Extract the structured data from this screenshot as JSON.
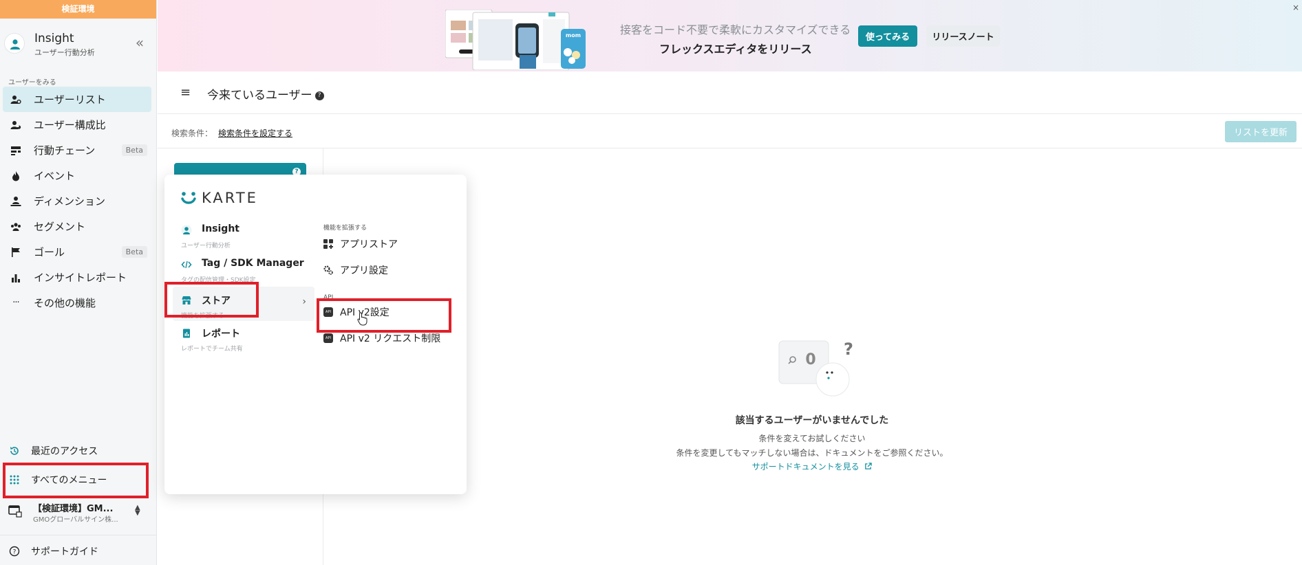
{
  "env_label": "検証環境",
  "app": {
    "title": "Insight",
    "subtitle": "ユーザー行動分析"
  },
  "sidebar": {
    "section_label": "ユーザーをみる",
    "items": [
      {
        "label": "ユーザーリスト",
        "icon": "user-list-icon",
        "active": true
      },
      {
        "label": "ユーザー構成比",
        "icon": "user-ratio-icon"
      },
      {
        "label": "行動チェーン",
        "icon": "action-chain-icon",
        "badge": "Beta"
      },
      {
        "label": "イベント",
        "icon": "event-icon"
      },
      {
        "label": "ディメンション",
        "icon": "dimension-icon"
      },
      {
        "label": "セグメント",
        "icon": "segment-icon"
      },
      {
        "label": "ゴール",
        "icon": "goal-flag-icon",
        "badge": "Beta"
      },
      {
        "label": "インサイトレポート",
        "icon": "report-chart-icon"
      },
      {
        "label": "その他の機能",
        "icon": "more-icon"
      }
    ],
    "recent_access": "最近のアクセス",
    "all_menu": "すべてのメニュー",
    "workspace_name": "【検証環境】GM...",
    "workspace_sub": "GMOグローバルサイン株...",
    "support_guide": "サポートガイド"
  },
  "banner": {
    "text1": "接客をコード不要で柔軟にカスタマイズできる",
    "text2": "フレックスエディタをリリース",
    "try_label": "使ってみる",
    "notes_label": "リリースノート",
    "close": "×",
    "mock_brand": "mom"
  },
  "header": {
    "title": "今来ているユーザー",
    "help": "?",
    "cond_label": "検索条件：",
    "cond_link": "検索条件を設定する",
    "refresh_label": "リストを更新"
  },
  "popup": {
    "logo": "KARTE",
    "left": [
      {
        "title": "Insight",
        "sub": "ユーザー行動分析",
        "icon": "user-circle-icon"
      },
      {
        "title": "Tag / SDK Manager",
        "sub": "タグの配信管理・SDK設定",
        "icon": "code-icon"
      },
      {
        "title": "ストア",
        "sub": "機能を拡張する",
        "icon": "store-icon",
        "selected": true
      },
      {
        "title": "レポート",
        "sub": "レポートでチーム共有",
        "icon": "report-icon"
      }
    ],
    "ext_head": "機能を拡張する",
    "app_store": "アプリストア",
    "app_settings": "アプリ設定",
    "api_head": "API",
    "api_settings": "API v2設定",
    "api_limits": "API v2 リクエスト制限",
    "api_badge": "API"
  },
  "empty": {
    "count": "0",
    "question": "?",
    "title": "該当するユーザーがいませんでした",
    "line1": "条件を変えてお試しください",
    "line2": "条件を変更してもマッチしない場合は、ドキュメントをご参照ください。",
    "link": "サポートドキュメントを見る"
  },
  "colors": {
    "accent": "#138f9e",
    "env": "#f9a95b",
    "highlight": "#e0202a",
    "active_bg": "#d8edf1"
  }
}
